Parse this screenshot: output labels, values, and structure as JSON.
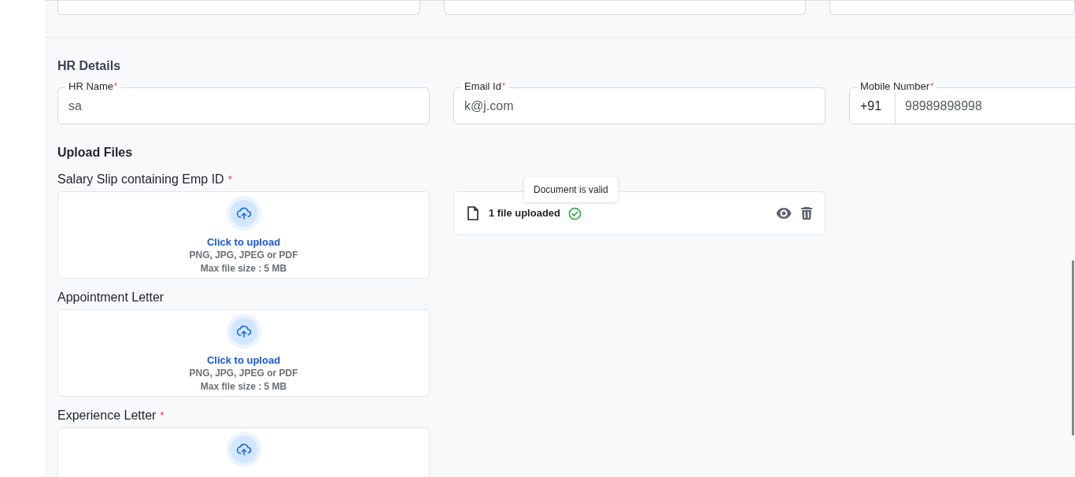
{
  "hr_details": {
    "title": "HR Details",
    "fields": [
      {
        "label": "HR Name",
        "required_mark": "*",
        "value": "sa"
      },
      {
        "label": "Email Id",
        "required_mark": "*",
        "value": "k@j.com"
      },
      {
        "label": "Mobile Number",
        "required_mark": "*",
        "prefix": "+91",
        "value": "98989898998"
      }
    ]
  },
  "upload_files": {
    "title": "Upload Files",
    "items": [
      {
        "label": "Salary Slip containing Emp ID",
        "required_mark": "*",
        "link": "Click to upload",
        "formats": "PNG, JPG, JPEG or PDF",
        "max_size": "Max file size : 5 MB",
        "uploaded": {
          "text": "1 file uploaded",
          "valid": true,
          "tooltip": "Document is valid"
        }
      },
      {
        "label": "Appointment Letter",
        "link": "Click to upload",
        "formats": "PNG, JPG, JPEG or PDF",
        "max_size": "Max file size : 5 MB"
      },
      {
        "label": "Experience Letter",
        "required_mark": "*"
      }
    ]
  }
}
